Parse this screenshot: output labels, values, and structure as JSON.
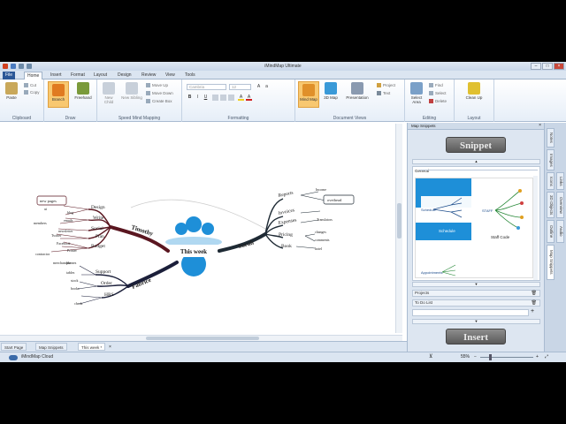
{
  "window": {
    "title": "iMindMap Ultimate"
  },
  "tabs": [
    "File",
    "Home",
    "Insert",
    "Format",
    "Layout",
    "Design",
    "Review",
    "View",
    "Tools"
  ],
  "ribbon": {
    "clipboard": {
      "paste": "Paste",
      "cut": "Cut",
      "copy": "Copy",
      "group": "Clipboard"
    },
    "draw": {
      "branch": "Branch",
      "freehand": "Freehand",
      "group": "Draw"
    },
    "speed": {
      "new_child": "New Child",
      "new_sibling": "New Sibling",
      "move_up": "Move Up",
      "move_down": "Move Down",
      "create_box": "Create Box",
      "group": "Speed Mind Mapping"
    },
    "formatting": {
      "font": "Cambria",
      "size": "12",
      "group": "Formatting"
    },
    "views": {
      "mind_map": "Mind Map",
      "map_3d": "3D Map",
      "presentation": "Presentation",
      "project": "Project",
      "text": "Text",
      "group": "Document Views"
    },
    "editing": {
      "select_area": "Select Area",
      "find": "Find",
      "select": "Select",
      "delete": "Delete",
      "group": "Editing"
    },
    "layout": {
      "clean_up": "Clean Up",
      "group": "Layout"
    }
  },
  "map": {
    "central": "This week",
    "branches": {
      "timothy": "Timothy",
      "sarah": "Sarah",
      "fabrice": "Fabrice",
      "design": "Design",
      "write": "Write",
      "social": "Social",
      "plan": "Plan",
      "budget": "Budget",
      "reports": "Reports",
      "invoices": "Invoices",
      "expenses": "Expenses",
      "pricing": "Pricing",
      "book": "Book",
      "support": "Support",
      "order": "Order",
      "hrs": "HRS"
    },
    "twigs": {
      "new_pages": "new pages",
      "ui": "ui",
      "blog": "blog",
      "emails": "emails",
      "members": "members",
      "twitter": "Twitter",
      "newsletter": "newsletter",
      "facebook": "Facebook",
      "printer": "Printer",
      "contractor": "contractor",
      "merchandise": "merchandise",
      "income": "Income",
      "ovethead": "ovethead",
      "translators": "Translators",
      "changes": "changes",
      "comments": "comments",
      "hotel": "hotel",
      "phones": "phones",
      "tables": "tables",
      "stock": "stock",
      "books": "books",
      "check": "check"
    }
  },
  "panel": {
    "title": "Map Snippets",
    "snippet_btn": "Snippet",
    "general": "General",
    "preview": {
      "schedule": "Schedule",
      "staff_code": "Staff Code",
      "staff": "STAFF",
      "appointments": "Appointments"
    },
    "projects": "Projects",
    "todo": "To Do List",
    "insert_btn": "Insert",
    "side_tabs": [
      "Notes",
      "Images",
      "Icons",
      "Links",
      "3D Objects",
      "Overview",
      "Outline",
      "Audio",
      "Map Snippets"
    ]
  },
  "doc_tabs": [
    "Start Page",
    "Map Snippets",
    "This week *"
  ],
  "status": {
    "cloud": "iMindMap Cloud",
    "zoom": "55%"
  },
  "colors": {
    "timothy": "#5a1620",
    "sarah": "#1e2a34",
    "fabrice": "#1b1f3a",
    "accent": "#2b5797",
    "central": "#1e8fd8"
  }
}
